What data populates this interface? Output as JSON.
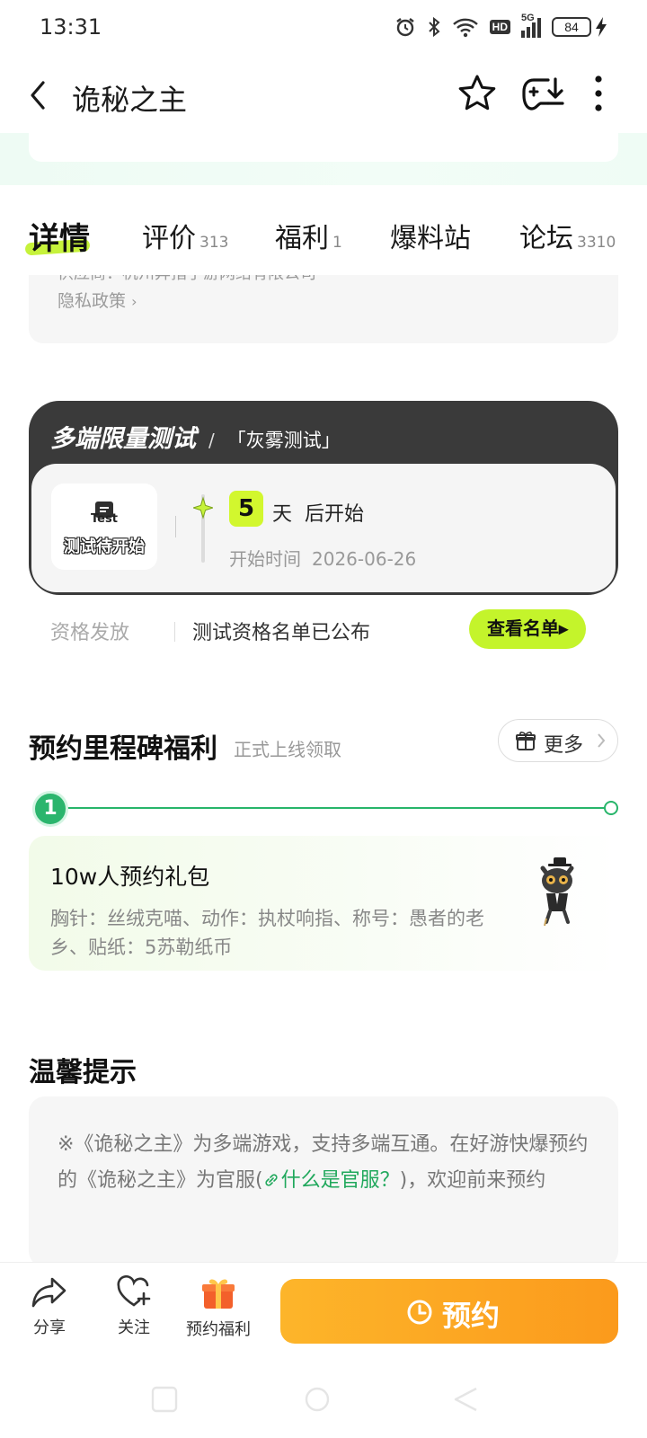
{
  "status_bar": {
    "time": "13:31",
    "network": "5G",
    "hd": "HD",
    "battery": "84"
  },
  "nav": {
    "title": "诡秘之主"
  },
  "tabs": [
    {
      "label": "详情",
      "count": ""
    },
    {
      "label": "评价",
      "count": "313"
    },
    {
      "label": "福利",
      "count": "1"
    },
    {
      "label": "爆料站",
      "count": ""
    },
    {
      "label": "论坛",
      "count": "3310"
    }
  ],
  "info": {
    "cut_line": "供应商：杭州异指手游网络有限公司",
    "privacy_link": "隐私政策"
  },
  "test": {
    "title": "多端限量测试",
    "separator": "/",
    "type": "「灰雾测试」",
    "badge_icon_text": "Test",
    "badge_label": "测试待开始",
    "days": "5",
    "days_unit": "天",
    "days_after": "后开始",
    "start_label": "开始时间",
    "start_date": "2026-06-26"
  },
  "qualification": {
    "label": "资格发放",
    "status": "测试资格名单已公布",
    "button": "查看名单▸"
  },
  "milestone": {
    "title": "预约里程碑福利",
    "subtitle": "正式上线领取",
    "more": "更多",
    "node_number": "1",
    "card_title": "10w人预约礼包",
    "card_desc": "胸针：丝绒克喵、动作：执杖响指、称号：愚者的老乡、贴纸：5苏勒纸币"
  },
  "tips": {
    "title": "温馨提示",
    "text_before": "※《诡秘之主》为多端游戏，支持多端互通。在好游快爆预约的《诡秘之主》为官服(",
    "link": "什么是官服？",
    "text_after": ")，欢迎前来预约"
  },
  "bottom_bar": {
    "share": "分享",
    "follow": "关注",
    "welfare": "预约福利",
    "reserve": "预约"
  },
  "colors": {
    "accent_green": "#c4f42b",
    "brand_green": "#27b56a",
    "reserve_orange": "#fb9a1c"
  }
}
